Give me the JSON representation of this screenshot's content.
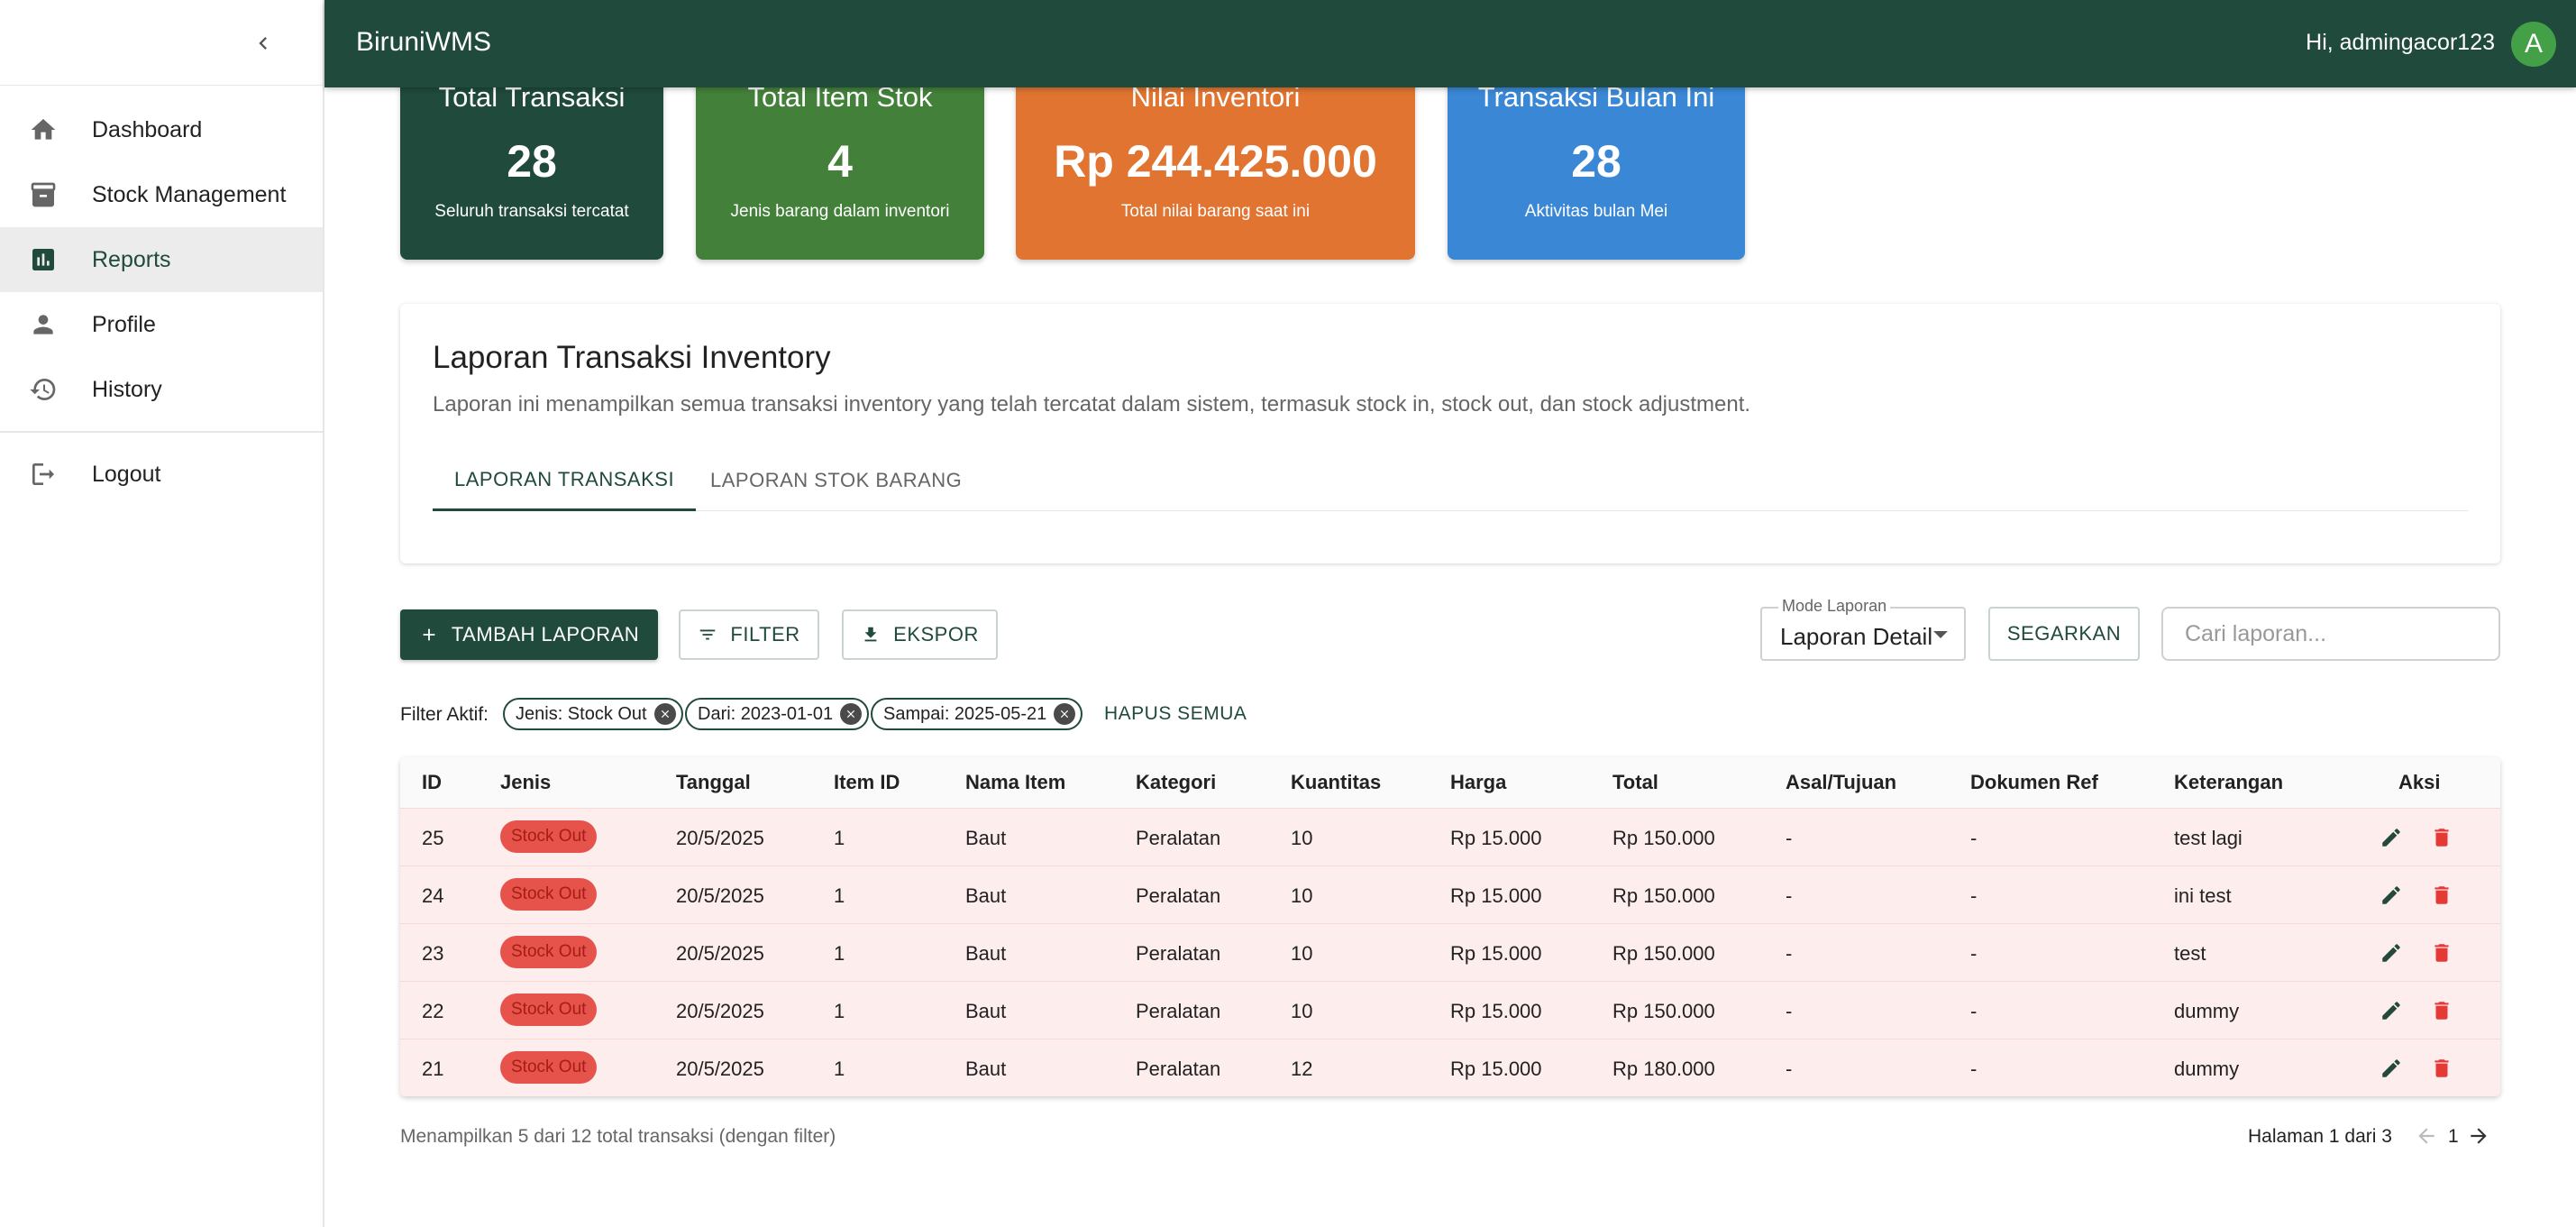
{
  "app": {
    "brand": "BiruniWMS",
    "greeting": "Hi, admingacor123",
    "avatar_initial": "A",
    "colors": {
      "primary": "#1f4a3c",
      "green": "#43813a",
      "orange": "#e07430",
      "blue": "#3a87d6",
      "badge_red": "#e5534b",
      "row_bg": "#fdeded",
      "delete_red": "#e53935"
    }
  },
  "sidebar": {
    "collapse_icon": "chevron-left-icon",
    "items": [
      {
        "label": "Dashboard",
        "icon": "home-icon"
      },
      {
        "label": "Stock Management",
        "icon": "archive-icon"
      },
      {
        "label": "Reports",
        "icon": "bar-chart-icon",
        "active": true
      },
      {
        "label": "Profile",
        "icon": "person-icon"
      },
      {
        "label": "History",
        "icon": "history-icon"
      }
    ],
    "logout": {
      "label": "Logout",
      "icon": "logout-icon"
    }
  },
  "stats": [
    {
      "title": "Total Transaksi",
      "value": "28",
      "sub": "Seluruh transaksi tercatat"
    },
    {
      "title": "Total Item Stok",
      "value": "4",
      "sub": "Jenis barang dalam inventori"
    },
    {
      "title": "Nilai Inventori",
      "value": "Rp 244.425.000",
      "sub": "Total nilai barang saat ini"
    },
    {
      "title": "Transaksi Bulan Ini",
      "value": "28",
      "sub": "Aktivitas bulan Mei"
    }
  ],
  "report": {
    "title": "Laporan Transaksi Inventory",
    "description": "Laporan ini menampilkan semua transaksi inventory yang telah tercatat dalam sistem, termasuk stock in, stock out, dan stock adjustment.",
    "tabs": [
      {
        "label": "LAPORAN TRANSAKSI",
        "active": true
      },
      {
        "label": "LAPORAN STOK BARANG"
      }
    ]
  },
  "toolbar": {
    "add_label": "TAMBAH LAPORAN",
    "filter_label": "FILTER",
    "export_label": "EKSPOR",
    "mode_label": "Mode Laporan",
    "mode_value": "Laporan Detail",
    "refresh_label": "SEGARKAN",
    "search_placeholder": "Cari laporan..."
  },
  "filters": {
    "label": "Filter Aktif:",
    "chips": [
      "Jenis: Stock Out",
      "Dari: 2023-01-01",
      "Sampai: 2025-05-21"
    ],
    "clear_label": "HAPUS SEMUA"
  },
  "table": {
    "headers": [
      "ID",
      "Jenis",
      "Tanggal",
      "Item ID",
      "Nama Item",
      "Kategori",
      "Kuantitas",
      "Harga",
      "Total",
      "Asal/Tujuan",
      "Dokumen Ref",
      "Keterangan",
      "Aksi"
    ],
    "rows": [
      {
        "id": "25",
        "jenis": "Stock Out",
        "tanggal": "20/5/2025",
        "item_id": "1",
        "nama": "Baut",
        "kategori": "Peralatan",
        "qty": "10",
        "harga": "Rp 15.000",
        "total": "Rp 150.000",
        "asal": "-",
        "ref": "-",
        "ket": "test lagi"
      },
      {
        "id": "24",
        "jenis": "Stock Out",
        "tanggal": "20/5/2025",
        "item_id": "1",
        "nama": "Baut",
        "kategori": "Peralatan",
        "qty": "10",
        "harga": "Rp 15.000",
        "total": "Rp 150.000",
        "asal": "-",
        "ref": "-",
        "ket": "ini test"
      },
      {
        "id": "23",
        "jenis": "Stock Out",
        "tanggal": "20/5/2025",
        "item_id": "1",
        "nama": "Baut",
        "kategori": "Peralatan",
        "qty": "10",
        "harga": "Rp 15.000",
        "total": "Rp 150.000",
        "asal": "-",
        "ref": "-",
        "ket": "test"
      },
      {
        "id": "22",
        "jenis": "Stock Out",
        "tanggal": "20/5/2025",
        "item_id": "1",
        "nama": "Baut",
        "kategori": "Peralatan",
        "qty": "10",
        "harga": "Rp 15.000",
        "total": "Rp 150.000",
        "asal": "-",
        "ref": "-",
        "ket": "dummy"
      },
      {
        "id": "21",
        "jenis": "Stock Out",
        "tanggal": "20/5/2025",
        "item_id": "1",
        "nama": "Baut",
        "kategori": "Peralatan",
        "qty": "12",
        "harga": "Rp 15.000",
        "total": "Rp 180.000",
        "asal": "-",
        "ref": "-",
        "ket": "dummy"
      }
    ]
  },
  "footer": {
    "summary": "Menampilkan 5 dari 12 total transaksi (dengan filter)",
    "page_text": "Halaman 1 dari 3",
    "page_num": "1"
  }
}
